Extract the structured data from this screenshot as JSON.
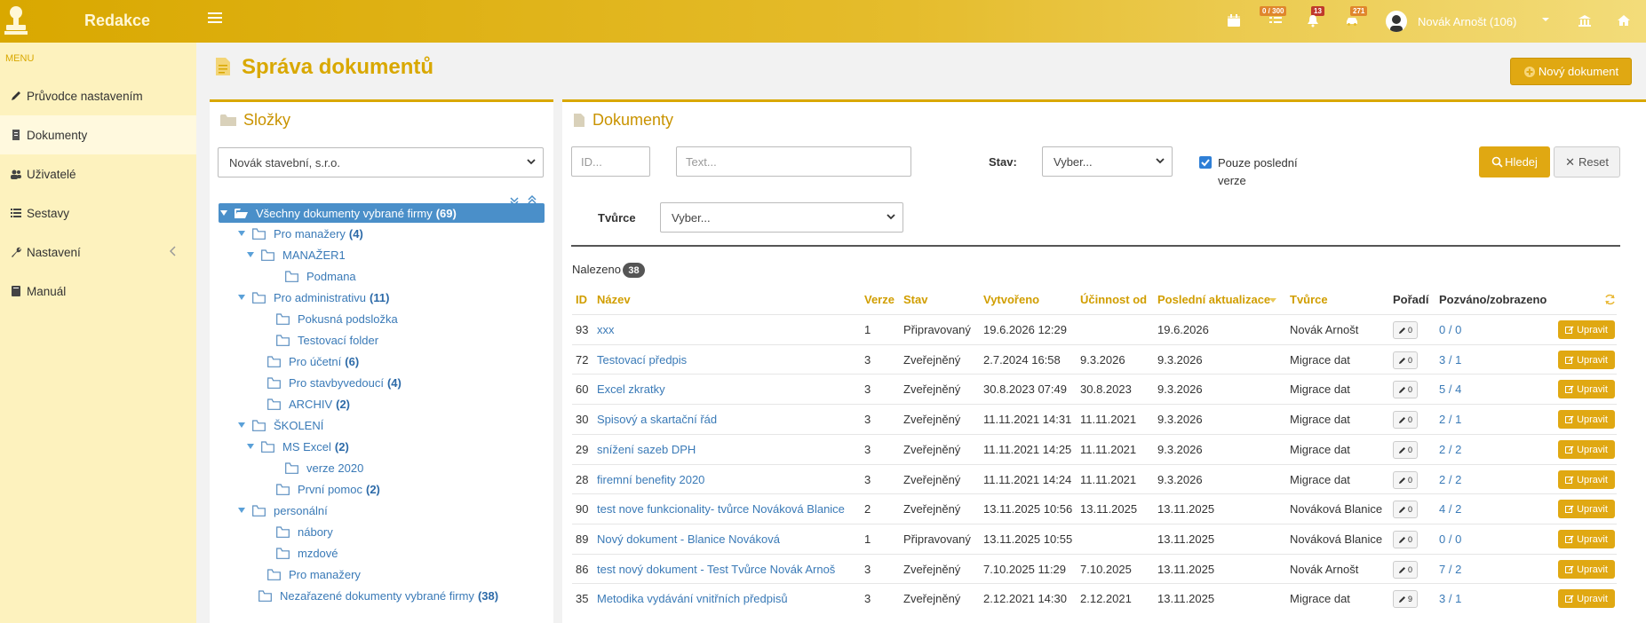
{
  "app": {
    "title": "Redakce"
  },
  "topbar": {
    "badge_tasks": "0 / 300",
    "badge_bell": "13",
    "badge_car": "271",
    "user_name": "Novák Arnošt (106)"
  },
  "sidebar": {
    "menu_label": "MENU",
    "items": [
      {
        "label": "Průvodce nastavením",
        "icon": "pencil-icon"
      },
      {
        "label": "Dokumenty",
        "icon": "document-icon"
      },
      {
        "label": "Uživatelé",
        "icon": "users-icon"
      },
      {
        "label": "Sestavy",
        "icon": "list-icon"
      },
      {
        "label": "Nastavení",
        "icon": "wrench-icon"
      },
      {
        "label": "Manuál",
        "icon": "book-icon"
      }
    ]
  },
  "page": {
    "title": "Správa dokumentů",
    "new_button": "Nový dokument"
  },
  "folders": {
    "title": "Složky",
    "company": "Novák stavební, s.r.o.",
    "tree": [
      {
        "label": "Všechny dokumenty vybrané firmy",
        "count": "(69)"
      },
      {
        "label": "Pro manažery",
        "count": "(4)"
      },
      {
        "label": "MANAŽER1",
        "count": ""
      },
      {
        "label": "Podmana",
        "count": ""
      },
      {
        "label": "Pro administrativu",
        "count": "(11)"
      },
      {
        "label": "Pokusná podsložka",
        "count": ""
      },
      {
        "label": "Testovací folder",
        "count": ""
      },
      {
        "label": "Pro účetní",
        "count": "(6)"
      },
      {
        "label": "Pro stavbyvedoucí",
        "count": "(4)"
      },
      {
        "label": "ARCHIV",
        "count": "(2)"
      },
      {
        "label": "ŠKOLENÍ",
        "count": ""
      },
      {
        "label": "MS Excel",
        "count": "(2)"
      },
      {
        "label": "verze 2020",
        "count": ""
      },
      {
        "label": "První pomoc",
        "count": "(2)"
      },
      {
        "label": "personální",
        "count": ""
      },
      {
        "label": "nábory",
        "count": ""
      },
      {
        "label": "mzdové",
        "count": ""
      },
      {
        "label": "Pro manažery",
        "count": ""
      },
      {
        "label": "Nezařazené dokumenty vybrané firmy",
        "count": "(38)"
      }
    ]
  },
  "documents": {
    "title": "Dokumenty",
    "filters": {
      "id_placeholder": "ID...",
      "text_placeholder": "Text...",
      "state_label": "Stav:",
      "state_value": "Vyber...",
      "latest_only_line1": "Pouze poslední",
      "latest_only_line2": "verze",
      "search_button": "Hledej",
      "reset_button": "Reset",
      "creator_label": "Tvůrce",
      "creator_value": "Vyber..."
    },
    "found_label": "Nalezeno",
    "found_count": "38",
    "columns": {
      "id": "ID",
      "name": "Název",
      "version": "Verze",
      "state": "Stav",
      "created": "Vytvořeno",
      "effective": "Účinnost od",
      "updated": "Poslední aktualizace",
      "creator": "Tvůrce",
      "order": "Pořadí",
      "invited": "Pozváno/zobrazeno"
    },
    "edit_label": "Upravit",
    "rows": [
      {
        "id": "93",
        "name": "xxx",
        "version": "1",
        "state": "Připravovaný",
        "created": "19.6.2026 12:29",
        "effective": "",
        "updated": "19.6.2026",
        "creator": "Novák Arnošt",
        "order": "0",
        "invited": "0 / 0"
      },
      {
        "id": "72",
        "name": "Testovací předpis",
        "version": "3",
        "state": "Zveřejněný",
        "created": "2.7.2024 16:58",
        "effective": "9.3.2026",
        "updated": "9.3.2026",
        "creator": "Migrace dat",
        "order": "0",
        "invited": "3 / 1"
      },
      {
        "id": "60",
        "name": "Excel zkratky",
        "version": "3",
        "state": "Zveřejněný",
        "created": "30.8.2023 07:49",
        "effective": "30.8.2023",
        "updated": "9.3.2026",
        "creator": "Migrace dat",
        "order": "0",
        "invited": "5 / 4"
      },
      {
        "id": "30",
        "name": "Spisový a skartační řád",
        "version": "3",
        "state": "Zveřejněný",
        "created": "11.11.2021 14:31",
        "effective": "11.11.2021",
        "updated": "9.3.2026",
        "creator": "Migrace dat",
        "order": "0",
        "invited": "2 / 1"
      },
      {
        "id": "29",
        "name": "snížení sazeb DPH",
        "version": "3",
        "state": "Zveřejněný",
        "created": "11.11.2021 14:25",
        "effective": "11.11.2021",
        "updated": "9.3.2026",
        "creator": "Migrace dat",
        "order": "0",
        "invited": "2 / 2"
      },
      {
        "id": "28",
        "name": "firemní benefity 2020",
        "version": "3",
        "state": "Zveřejněný",
        "created": "11.11.2021 14:24",
        "effective": "11.11.2021",
        "updated": "9.3.2026",
        "creator": "Migrace dat",
        "order": "0",
        "invited": "2 / 2"
      },
      {
        "id": "90",
        "name": "test nove funkcionality- tvůrce Nováková Blanice",
        "version": "2",
        "state": "Zveřejněný",
        "created": "13.11.2025 10:56",
        "effective": "13.11.2025",
        "updated": "13.11.2025",
        "creator": "Nováková Blanice",
        "order": "0",
        "invited": "4 / 2"
      },
      {
        "id": "89",
        "name": "Nový dokument - Blanice Nováková",
        "version": "1",
        "state": "Připravovaný",
        "created": "13.11.2025 10:55",
        "effective": "",
        "updated": "13.11.2025",
        "creator": "Nováková Blanice",
        "order": "0",
        "invited": "0 / 0"
      },
      {
        "id": "86",
        "name": "test nový dokument - Test Tvůrce Novák Arnoš",
        "version": "3",
        "state": "Zveřejněný",
        "created": "7.10.2025 11:29",
        "effective": "7.10.2025",
        "updated": "13.11.2025",
        "creator": "Novák Arnošt",
        "order": "0",
        "invited": "7 / 2"
      },
      {
        "id": "35",
        "name": "Metodika vydávání vnitřních předpisů",
        "version": "3",
        "state": "Zveřejněný",
        "created": "2.12.2021 14:30",
        "effective": "2.12.2021",
        "updated": "13.11.2025",
        "creator": "Migrace dat",
        "order": "9",
        "invited": "3 / 1"
      }
    ]
  }
}
